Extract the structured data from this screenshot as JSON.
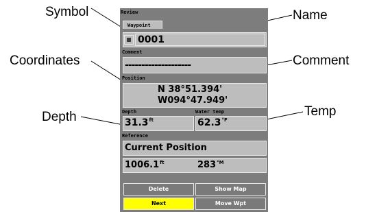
{
  "screen": {
    "title": "Review",
    "tab_label": "Waypoint",
    "name": "0001",
    "comment_label": "Comment",
    "comment_value": "--------------------",
    "position_label": "Position",
    "lat": "N 38°51.394'",
    "lon": "W094°47.949'",
    "depth_label": "Depth",
    "depth_value": "31.3",
    "depth_unit": "ft",
    "water_temp_label": "Water temp",
    "water_temp_value": "62.3",
    "water_temp_unit": "°F",
    "reference_label": "Reference",
    "reference_value": "Current Position",
    "distance_value": "1006.1",
    "distance_unit": "ft",
    "bearing_value": "283",
    "bearing_unit": "°M",
    "buttons": {
      "delete": "Delete",
      "show_map": "Show Map",
      "next": "Next",
      "move_wpt": "Move Wpt"
    }
  },
  "callouts": {
    "symbol": "Symbol",
    "coordinates": "Coordinates",
    "depth": "Depth",
    "name": "Name",
    "comment": "Comment",
    "temp": "Temp"
  },
  "colors": {
    "panel": "#7d7d7d",
    "field": "#bdbdbd",
    "selected_button": "#ffff00"
  }
}
